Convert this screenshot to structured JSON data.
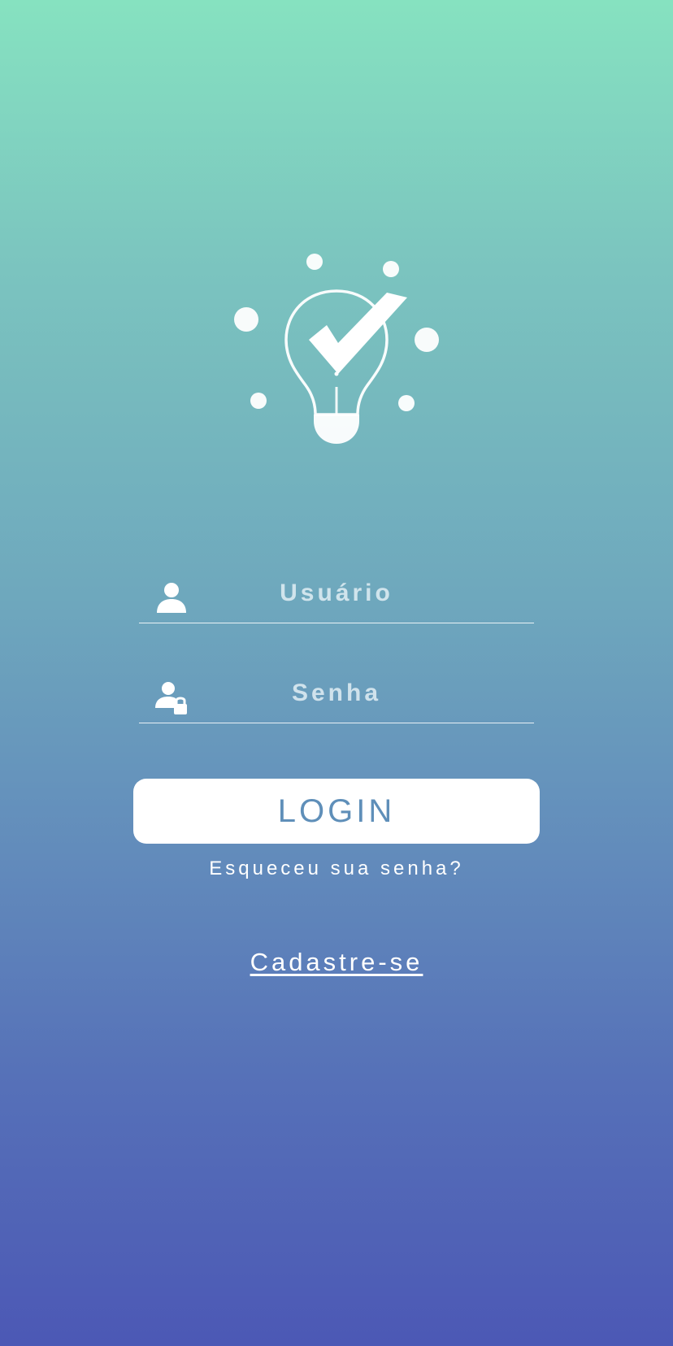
{
  "login_form": {
    "username": {
      "placeholder": "Usuário",
      "value": "",
      "icon": "user-icon"
    },
    "password": {
      "placeholder": "Senha",
      "value": "",
      "icon": "user-lock-icon"
    },
    "login_button_label": "LOGIN",
    "forgot_password_label": "Esqueceu sua senha?",
    "signup_label": "Cadastre-se"
  },
  "logo": {
    "icon": "lightbulb-check-icon"
  },
  "colors": {
    "gradient_top": "#86e2c0",
    "gradient_bottom": "#4c58b5",
    "button_bg": "#ffffff",
    "button_text": "#5f8fb9",
    "text": "#ffffff"
  }
}
